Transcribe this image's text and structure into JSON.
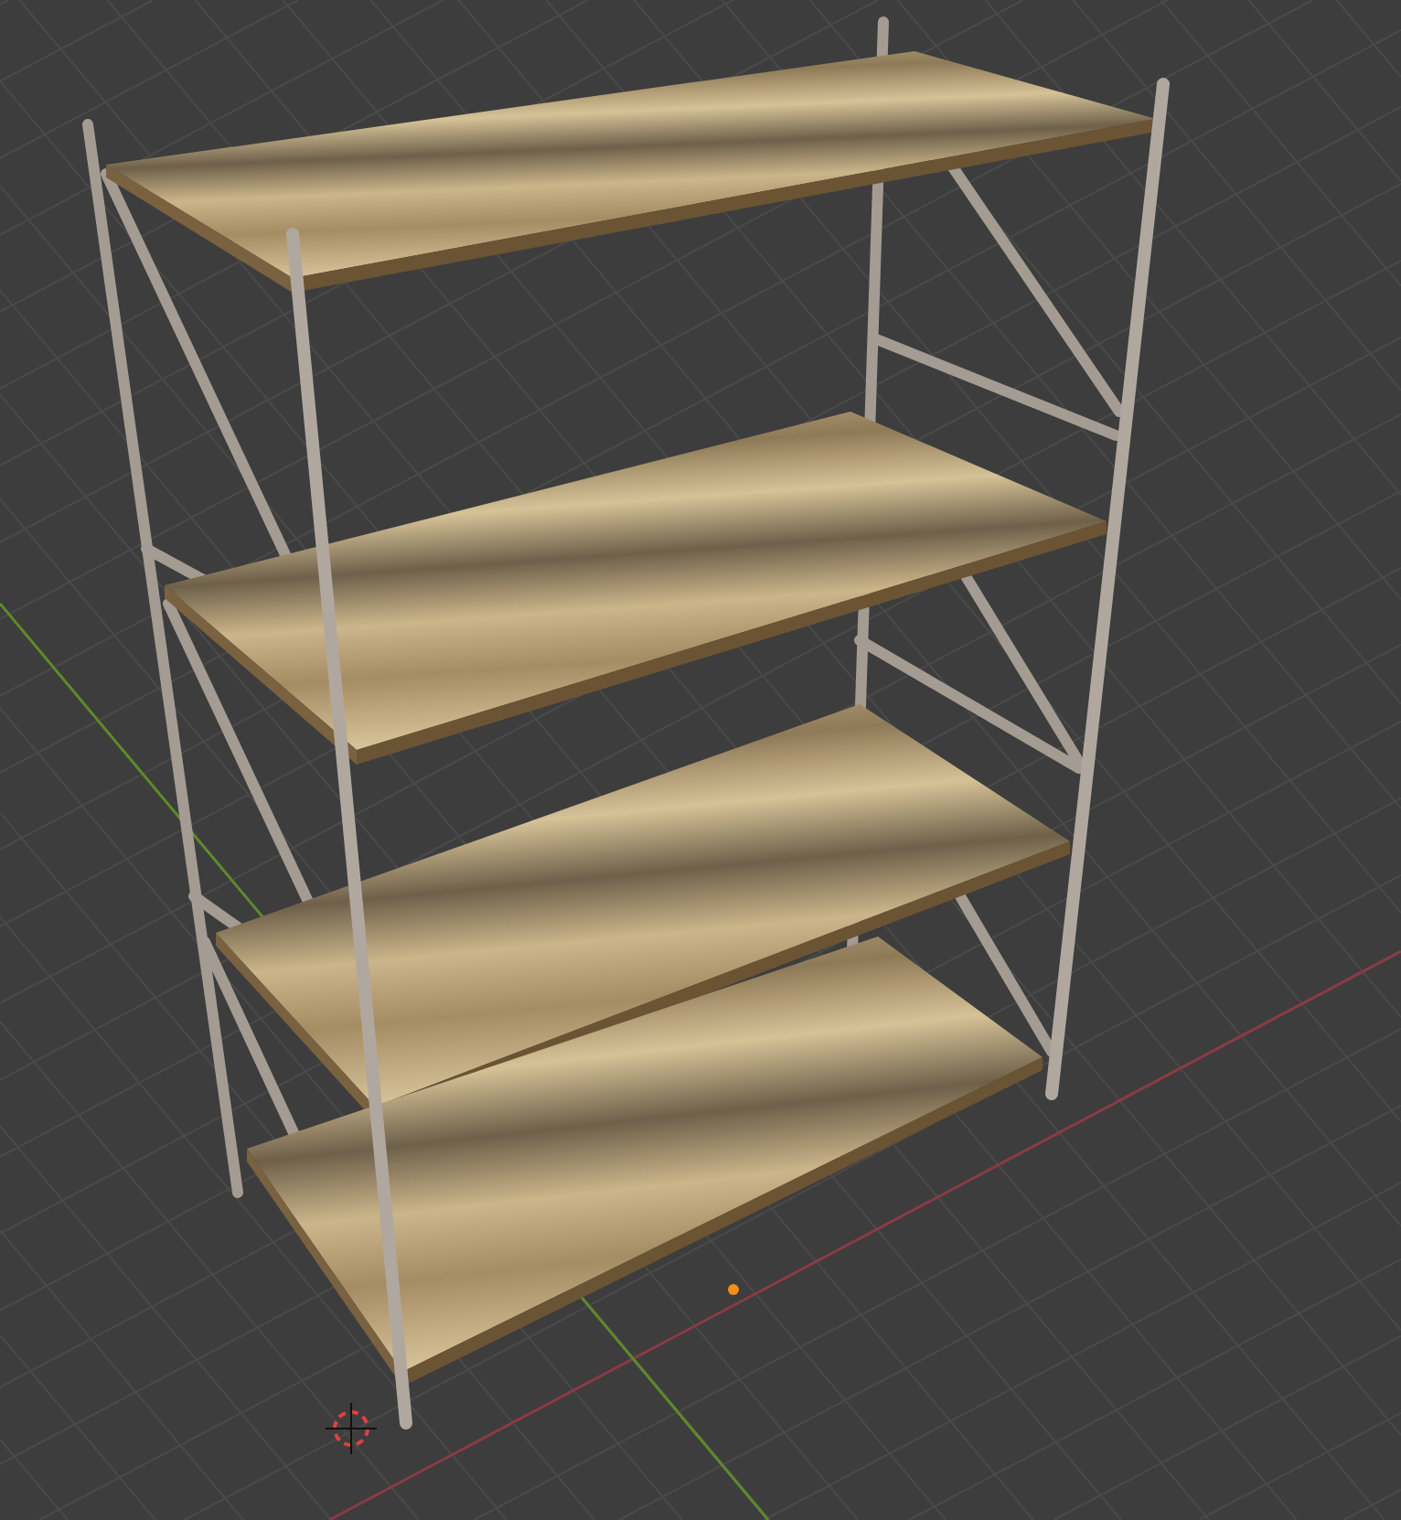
{
  "viewport": {
    "objects": [
      {
        "kind": "shelf"
      }
    ]
  }
}
